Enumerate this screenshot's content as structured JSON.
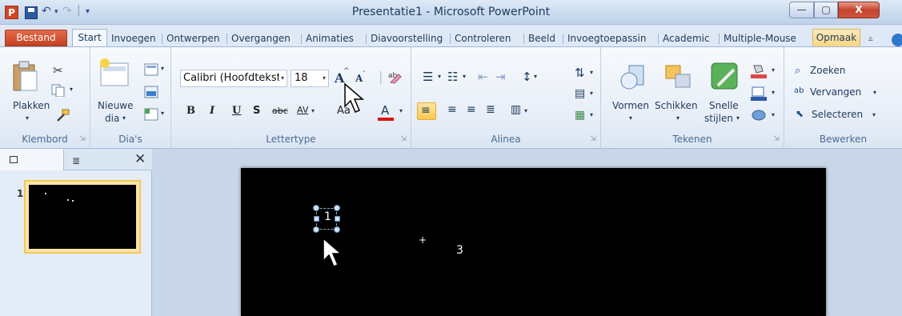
{
  "window": {
    "title": "Presentatie1 - Microsoft PowerPoint",
    "logo": "P",
    "minimize": "—",
    "maximize": "▢",
    "close": "X"
  },
  "qat": {
    "undo": "↶",
    "undo_arrow": "▾",
    "redo": "↷",
    "sep": "|",
    "customize": "▾"
  },
  "tabs": {
    "file": "Bestand",
    "items": [
      "Start",
      "Invoegen",
      "Ontwerpen",
      "Overgangen",
      "Animaties",
      "Diavoorstelling",
      "Controleren",
      "Beeld",
      "Invoegtoepassin",
      "Academic",
      "Multiple-Mouse",
      "Opmaak"
    ],
    "minimize_icon": "▵"
  },
  "ribbon": {
    "clipboard": {
      "paste": "Plakken",
      "label": "Klembord"
    },
    "slides": {
      "new_slide_line1": "Nieuwe",
      "new_slide_line2": "dia",
      "label": "Dia's"
    },
    "font": {
      "name": "Calibri (Hoofdtekst",
      "size": "18",
      "grow": "A",
      "shrink": "A",
      "bold": "B",
      "italic": "I",
      "underline": "U",
      "shadow": "S",
      "strike": "abc",
      "spacing": "AV",
      "case": "Aa",
      "color": "A",
      "label": "Lettertype"
    },
    "paragraph": {
      "label": "Alinea"
    },
    "drawing": {
      "shapes": "Vormen",
      "arrange": "Schikken",
      "quick_styles_line1": "Snelle",
      "quick_styles_line2": "stijlen",
      "label": "Tekenen"
    },
    "editing": {
      "find": "Zoeken",
      "replace": "Vervangen",
      "select": "Selecteren",
      "label": "Bewerken"
    }
  },
  "panel": {
    "close": "✕",
    "slide_number": "1",
    "outline_icon": "≣"
  },
  "slide": {
    "label_1": "1",
    "plus": "+",
    "label_3": "3"
  },
  "colors": {
    "file_tab": "#c9432a",
    "accent": "#f7d67f",
    "font_color_bar": "#e01010"
  }
}
